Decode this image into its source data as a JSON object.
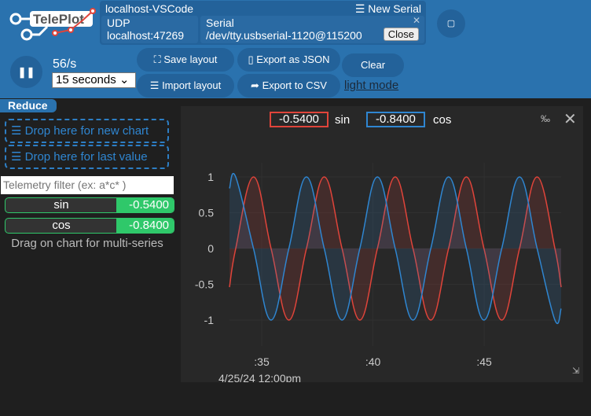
{
  "header": {
    "logo_text": "TelePlot",
    "connection": {
      "title": "localhost-VSCode",
      "new_serial": "New Serial",
      "new_serial_icon": "list-icon",
      "udp": {
        "label": "UDP",
        "address": "localhost:47269"
      },
      "serial": {
        "label": "Serial",
        "port": "/dev/tty.usbserial-1120@115200",
        "close_label": "Close"
      }
    },
    "rate": "56/s",
    "window_select": "15 seconds",
    "buttons": {
      "save_layout": "Save layout",
      "import_layout": "Import layout",
      "export_json": "Export as JSON",
      "export_csv": "Export to CSV",
      "clear": "Clear"
    },
    "light_mode": "light mode"
  },
  "sidebar": {
    "reduce": "Reduce",
    "drop_new_chart": "Drop here for new chart",
    "drop_last_value": "Drop here for last value",
    "filter_placeholder": "Telemetry filter (ex: a*c* )",
    "telemetry": [
      {
        "name": "sin",
        "value": "-0.5400"
      },
      {
        "name": "cos",
        "value": "-0.8400"
      }
    ],
    "hint": "Drag on chart for multi-series"
  },
  "chart_data": {
    "type": "area",
    "legend": [
      {
        "name": "sin",
        "value": "-0.5400",
        "color": "#e0443a"
      },
      {
        "name": "cos",
        "value": "-0.8400",
        "color": "#2f86d1"
      }
    ],
    "xlim": [
      33.55,
      48.46
    ],
    "ylim": [
      -1.3,
      1.45
    ],
    "x_ticks": [
      {
        "v": 35,
        "label": ":35"
      },
      {
        "v": 40,
        "label": ":40"
      },
      {
        "v": 45,
        "label": ":45"
      }
    ],
    "y_ticks": [
      {
        "v": 1,
        "label": "1"
      },
      {
        "v": 0.5,
        "label": "0.5"
      },
      {
        "v": 0,
        "label": "0"
      },
      {
        "v": -0.5,
        "label": "-0.5"
      },
      {
        "v": -1,
        "label": "-1"
      }
    ],
    "date_label": "4/25/24 12:00pm",
    "grid": true,
    "series": [
      {
        "name": "sin",
        "color": "#e0443a",
        "x": [
          33.55,
          33.83,
          34.63,
          35.42,
          36.22,
          37.01,
          37.81,
          38.61,
          39.41,
          40.2,
          41.0,
          41.8,
          42.6,
          43.4,
          44.2,
          44.99,
          45.79,
          46.59,
          47.38,
          48.18,
          48.46
        ],
        "y": [
          -0.54,
          0,
          1,
          0,
          -1,
          0,
          1,
          0,
          -1,
          0,
          1,
          0,
          -1,
          0,
          1,
          0,
          -1,
          0,
          1,
          0,
          -0.54
        ]
      },
      {
        "name": "cos",
        "color": "#2f86d1",
        "x": [
          33.55,
          33.83,
          34.63,
          35.42,
          36.22,
          37.01,
          37.81,
          38.61,
          39.41,
          40.2,
          41.0,
          41.8,
          42.6,
          43.4,
          44.2,
          44.99,
          45.79,
          46.59,
          47.38,
          48.18,
          48.46
        ],
        "y": [
          0.84,
          1,
          0,
          -1,
          0,
          1,
          0,
          -1,
          0,
          1,
          0,
          -1,
          0,
          1,
          0,
          -1,
          0,
          1,
          0,
          -1,
          -0.84
        ]
      }
    ]
  }
}
